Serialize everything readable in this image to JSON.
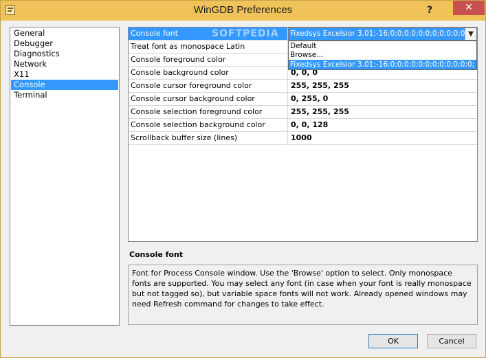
{
  "window": {
    "title": "WinGDB Preferences",
    "help_label": "?",
    "close_label": "✕"
  },
  "categories": [
    {
      "label": "General"
    },
    {
      "label": "Debugger"
    },
    {
      "label": "Diagnostics"
    },
    {
      "label": "Network"
    },
    {
      "label": "X11"
    },
    {
      "label": "Console"
    },
    {
      "label": "Terminal"
    }
  ],
  "selected_category": "Console",
  "properties": [
    {
      "name": "Console font",
      "value": "Fixedsys Excelsior 3.01;-16;0;0;0;0;0;0;0;0;0;0;0;0;"
    },
    {
      "name": "Treat font as monospace Latin",
      "value": ""
    },
    {
      "name": "Console foreground color",
      "value": ""
    },
    {
      "name": "Console background color",
      "value": "0, 0, 0"
    },
    {
      "name": "Console cursor foreground color",
      "value": "255, 255, 255"
    },
    {
      "name": "Console cursor background color",
      "value": "0, 255, 0"
    },
    {
      "name": "Console selection foreground color",
      "value": "255, 255, 255"
    },
    {
      "name": "Console selection background color",
      "value": "0, 0, 128"
    },
    {
      "name": "Scrollback buffer size (lines)",
      "value": "1000"
    }
  ],
  "font_dropdown": {
    "current_value": "Fixedsys Excelsior 3.01;-16;0;0;0;0;0;0;0;0;0;0;0;0;",
    "options": [
      {
        "label": "Default"
      },
      {
        "label": "Browse..."
      },
      {
        "label": "Fixedsys Excelsior 3.01;-16;0;0;0;0;0;0;0;0;0;0;0;0;"
      }
    ],
    "selected_index": 2,
    "arrow_icon": "chevron-down-icon"
  },
  "description": {
    "title": "Console font",
    "text": "Font for Process Console window. Use the 'Browse' option to select. Only monospace fonts are supported. You may select any font (in case when your font is really monospace but not tagged so), but variable space fonts will not work. Already opened windows may need Refresh command for changes to take effect."
  },
  "buttons": {
    "ok_label": "OK",
    "cancel_label": "Cancel"
  },
  "watermark": "SOFTPEDIA",
  "colors": {
    "titlebar": "#f0c35a",
    "close_button": "#c75050",
    "selection": "#3399ff"
  }
}
